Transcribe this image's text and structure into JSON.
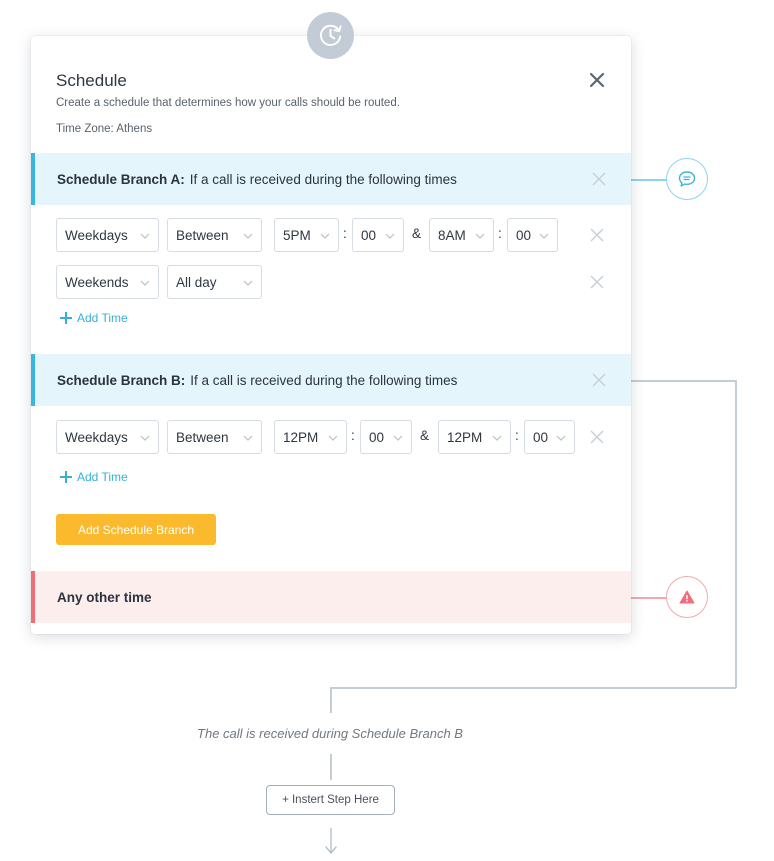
{
  "modal": {
    "title": "Schedule",
    "description": "Create a schedule that determines how your calls should be routed.",
    "timezone": "Time Zone: Athens"
  },
  "branch_a": {
    "name": "Schedule Branch A:",
    "condition": "If a call is received during the following times",
    "rows": [
      {
        "days": "Weekdays",
        "mode": "Between",
        "from_hour": "5PM",
        "from_min": "00",
        "to_hour": "8AM",
        "to_min": "00"
      },
      {
        "days": "Weekends",
        "mode": "All day"
      }
    ],
    "add_time": "Add Time"
  },
  "branch_b": {
    "name": "Schedule Branch B:",
    "condition": "If a call is received during the following times",
    "rows": [
      {
        "days": "Weekdays",
        "mode": "Between",
        "from_hour": "12PM",
        "from_min": "00",
        "to_hour": "12PM",
        "to_min": "00"
      }
    ],
    "add_time": "Add Time"
  },
  "add_branch_label": "Add Schedule Branch",
  "other_time_label": "Any other time",
  "separators": {
    "colon": ":",
    "and": "&"
  },
  "flow": {
    "caption": "The call is received during Schedule Branch B",
    "insert_label": "+ Instert Step Here"
  },
  "icons": {
    "top": "clock-icon",
    "branch_a_badge": "chat-bubble-icon",
    "other_badge": "warning-icon",
    "close": "close-icon",
    "chevron": "chevron-down-icon",
    "add": "plus-icon",
    "arrow": "arrow-down-icon"
  },
  "colors": {
    "accent_blue": "#39b6e0",
    "branch_bg": "#e4f5fc",
    "warning_red": "#ee6f7a",
    "other_bg": "#fdeeee",
    "button_yellow": "#fbba2e",
    "connector": "#c4cdd6"
  }
}
